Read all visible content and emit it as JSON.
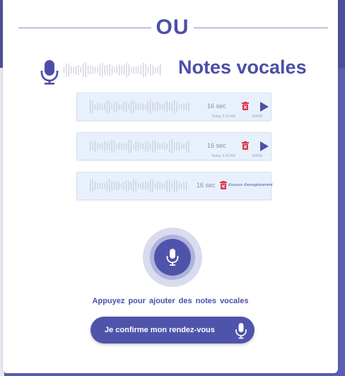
{
  "divider": {
    "label": "OU"
  },
  "header": {
    "title": "Notes vocales",
    "mic_icon": "microphone-icon"
  },
  "notes": [
    {
      "duration": "16 sec",
      "timestamp": "Today, 6:25 AM",
      "size": "300KB",
      "delete_icon": "trash-icon",
      "action_icon": "play-icon"
    },
    {
      "duration": "16 sec",
      "timestamp": "Today, 6:25 AM",
      "size": "300KB",
      "delete_icon": "trash-icon",
      "action_icon": "play-icon"
    }
  ],
  "recording": {
    "duration": "16 sec",
    "status": "Encours d'enregistrement",
    "delete_icon": "trash-icon"
  },
  "record_button": {
    "icon": "microphone-icon"
  },
  "hint": "Appuyez pour  ajouter des  notes vocales",
  "confirm_button": {
    "label": "Je confirme mon rendez-vous",
    "icon": "microphone-icon"
  },
  "colors": {
    "accent": "#4b4fa8",
    "delete": "#e0344f",
    "note_bg": "#e8f1fb",
    "wave": "#c4c8d6"
  }
}
